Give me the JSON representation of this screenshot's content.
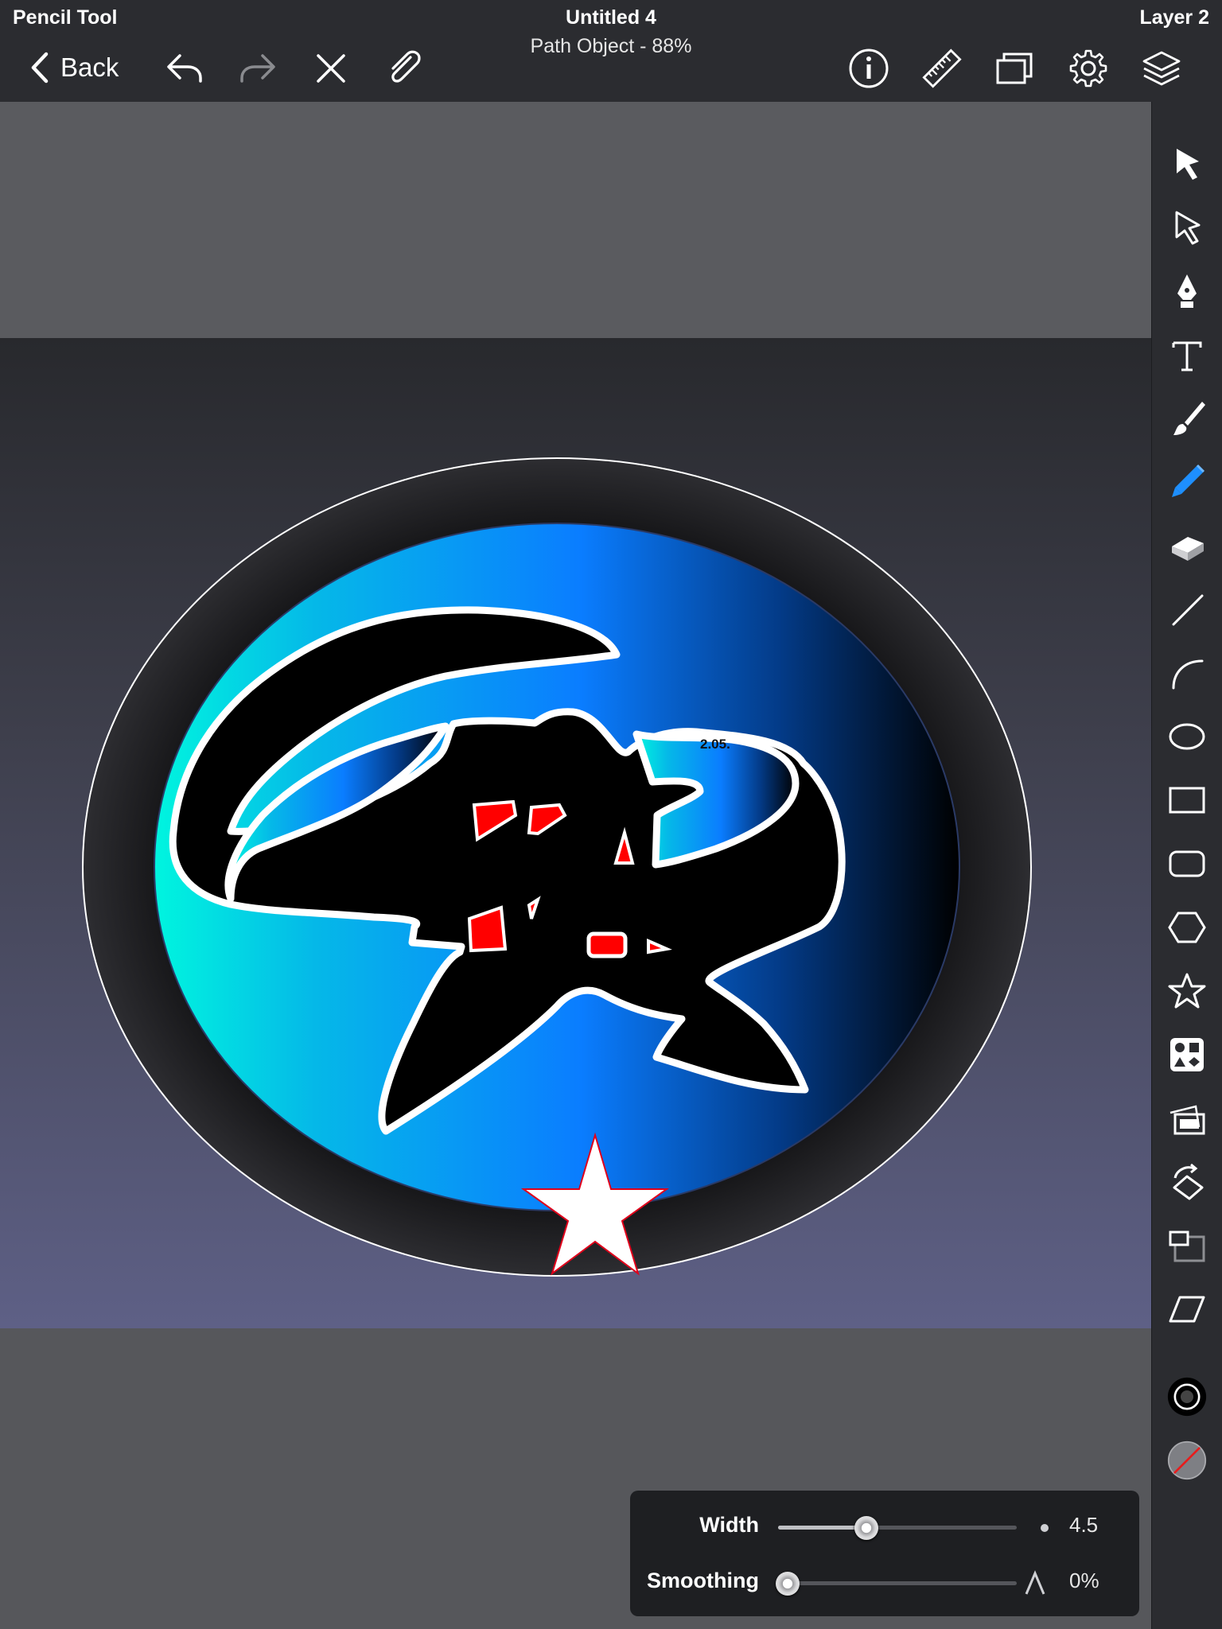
{
  "header": {
    "tool_name": "Pencil Tool",
    "doc_title": "Untitled 4",
    "doc_subtitle": "Path Object - 88%",
    "layer_name": "Layer 2",
    "back_label": "Back"
  },
  "toolbar": {
    "left_icons": [
      "undo-icon",
      "redo-icon",
      "close-icon",
      "paperclip-icon"
    ],
    "right_icons": [
      "info-icon",
      "ruler-icon",
      "artboards-icon",
      "gear-icon",
      "layers-icon"
    ]
  },
  "sidebar": {
    "tools": [
      "selection-arrow-icon",
      "direct-selection-icon",
      "pen-tool-icon",
      "text-tool-icon",
      "brush-tool-icon",
      "pencil-tool-icon",
      "eraser-tool-icon",
      "line-tool-icon",
      "arc-tool-icon",
      "ellipse-tool-icon",
      "rectangle-tool-icon",
      "rounded-rectangle-tool-icon",
      "polygon-tool-icon",
      "star-tool-icon",
      "shapes-library-icon",
      "image-import-icon",
      "transform-rotate-icon",
      "scale-tool-icon",
      "shear-tool-icon",
      "stroke-color-icon",
      "fill-color-icon"
    ],
    "active_tool": "pencil-tool-icon",
    "accent_color": "#1e8fff"
  },
  "stroke_panel": {
    "width_label": "Width",
    "width_value": "4.5",
    "width_fraction": 0.37,
    "smoothing_label": "Smoothing",
    "smoothing_value": "0%",
    "smoothing_fraction": 0.0
  },
  "artwork": {
    "partial_text": "2.05.",
    "colors": {
      "ring": "#1c1c1e",
      "gradient_left": "#00f0e0",
      "gradient_mid": "#0a7dff",
      "gradient_right": "#000000",
      "creature": "#000000",
      "eyes": "#ff0000",
      "star": "#ffffff"
    }
  }
}
